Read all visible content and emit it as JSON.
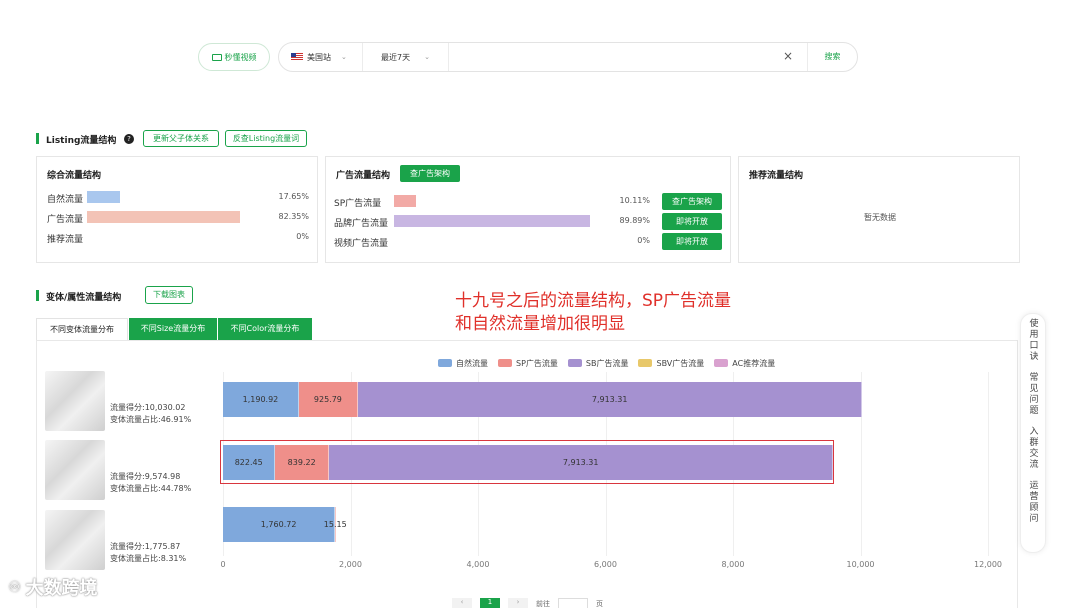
{
  "search": {
    "video_btn": "秒懂视频",
    "site": "美国站",
    "range": "最近7天",
    "clear": "×",
    "submit": "搜索"
  },
  "listing": {
    "title": "Listing流量结构",
    "btn_update": "更新父子体关系",
    "btn_reverse": "反查Listing流量词",
    "overall": {
      "title": "综合流量结构",
      "rows": [
        {
          "label": "自然流量",
          "pct": "17.65%",
          "ratio": 0.1765,
          "color": "#a9c7ee"
        },
        {
          "label": "广告流量",
          "pct": "82.35%",
          "ratio": 0.8235,
          "color": "#f3c3b6"
        },
        {
          "label": "推荐流量",
          "pct": "0%",
          "ratio": 0,
          "color": "#cccccc"
        }
      ]
    },
    "ads": {
      "title": "广告流量结构",
      "title_btn": "查广告架构",
      "rows": [
        {
          "label": "SP广告流量",
          "pct": "10.11%",
          "ratio": 0.1011,
          "color": "#f2aaa6",
          "btn": "查广告架构"
        },
        {
          "label": "品牌广告流量",
          "pct": "89.89%",
          "ratio": 0.8989,
          "color": "#c8b6e2",
          "btn": "即将开放"
        },
        {
          "label": "视频广告流量",
          "pct": "0%",
          "ratio": 0,
          "color": "#cccccc",
          "btn": "即将开放"
        }
      ]
    },
    "recommend": {
      "title": "推荐流量结构",
      "empty": "暂无数据"
    }
  },
  "variant": {
    "title": "变体/属性流量结构",
    "download": "下载图表",
    "tabs": [
      "不同变体流量分布",
      "不同Size流量分布",
      "不同Color流量分布"
    ],
    "annotation_line1": "十九号之后的流量结构，SP广告流量",
    "annotation_line2": "和自然流量增加很明显",
    "rows": [
      {
        "score": "流量得分:10,030.02",
        "share": "变体流量占比:46.91%"
      },
      {
        "score": "流量得分:9,574.98",
        "share": "变体流量占比:44.78%"
      },
      {
        "score": "流量得分:1,775.87",
        "share": "变体流量占比:8.31%"
      }
    ]
  },
  "chart_data": {
    "type": "bar",
    "orientation": "horizontal",
    "stacked": true,
    "legend": [
      {
        "name": "自然流量",
        "color": "#7fa8dc"
      },
      {
        "name": "SP广告流量",
        "color": "#ef8f8a"
      },
      {
        "name": "SB广告流量",
        "color": "#a591d0"
      },
      {
        "name": "SBV广告流量",
        "color": "#e8c86a"
      },
      {
        "name": "AC推荐流量",
        "color": "#d9a1cf"
      }
    ],
    "bars": [
      {
        "segments": [
          {
            "series": "自然流量",
            "value": 1190.92,
            "label": "1,190.92"
          },
          {
            "series": "SP广告流量",
            "value": 925.79,
            "label": "925.79"
          },
          {
            "series": "SB广告流量",
            "value": 7913.31,
            "label": "7,913.31"
          }
        ]
      },
      {
        "segments": [
          {
            "series": "自然流量",
            "value": 822.45,
            "label": "822.45"
          },
          {
            "series": "SP广告流量",
            "value": 839.22,
            "label": "839.22"
          },
          {
            "series": "SB广告流量",
            "value": 7913.31,
            "label": "7,913.31"
          }
        ]
      },
      {
        "segments": [
          {
            "series": "自然流量",
            "value": 1760.72,
            "label": "1,760.72"
          },
          {
            "series": "SP广告流量",
            "value": 15.15,
            "label": "15.15"
          }
        ]
      }
    ],
    "xlim": [
      0,
      12000
    ],
    "ticks": [
      "0",
      "2,000",
      "4,000",
      "6,000",
      "8,000",
      "10,000",
      "12,000"
    ]
  },
  "sidebar": [
    "使用口诀",
    "常见问题",
    "入群交流",
    "运营顾问"
  ],
  "watermark": "大数跨境",
  "pager": {
    "label": "前往",
    "unit": "页",
    "current": "1"
  }
}
